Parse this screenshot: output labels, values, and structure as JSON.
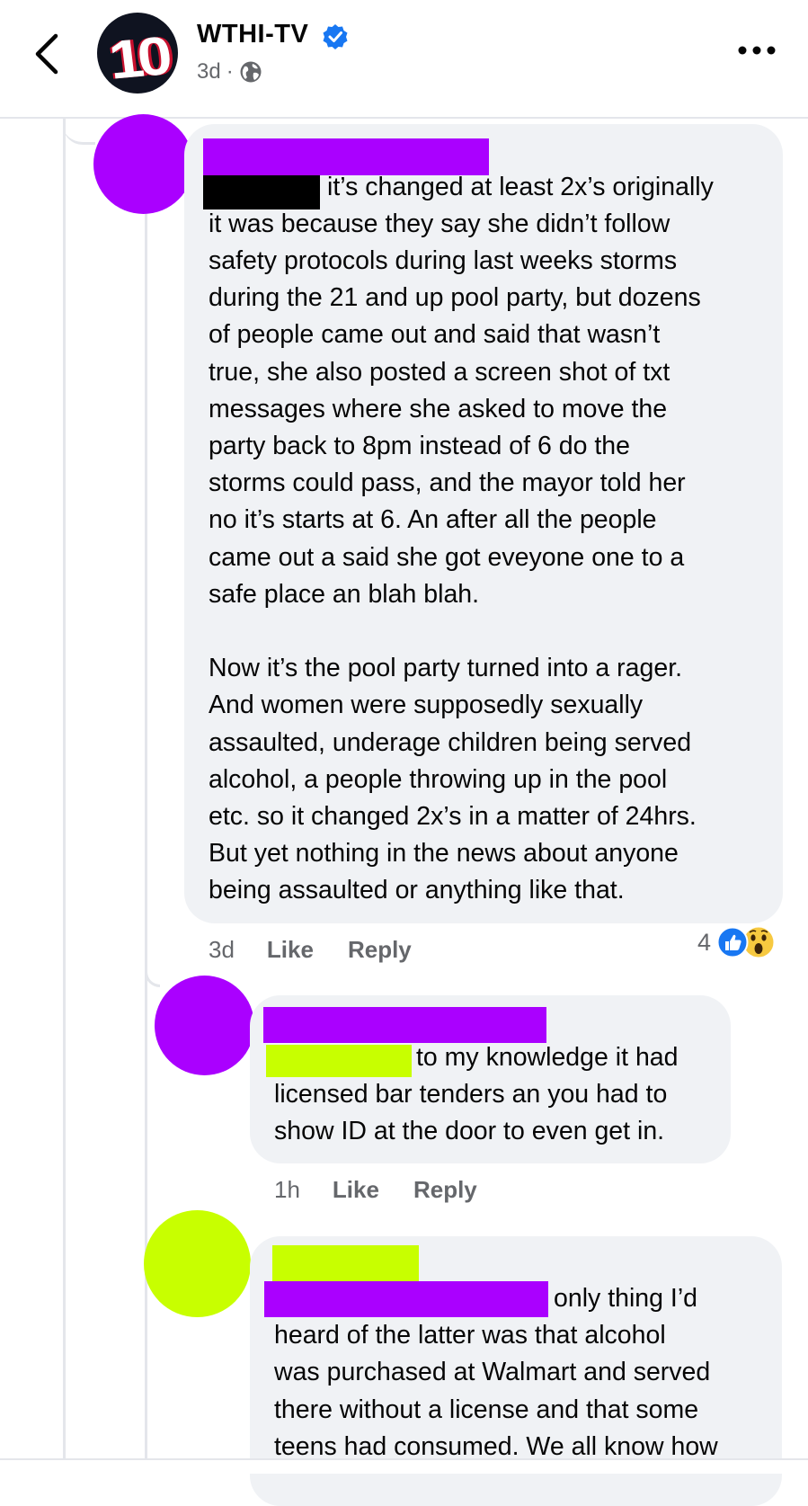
{
  "header": {
    "page_name": "WTHI-TV",
    "logo_text": "10",
    "time": "3d",
    "separator": "·"
  },
  "comments": [
    {
      "avatar_color": "#aa00ff",
      "lines": [
        "it’s changed at least 2x’s originally",
        "it was because they say she didn’t follow",
        "safety protocols during last weeks storms",
        "during the 21 and up pool party, but dozens",
        "of people came out and said that wasn’t",
        "true, she also posted a screen shot of txt",
        "messages where she asked to move the",
        "party back to 8pm instead of 6 do the",
        "storms could pass, and the mayor told her",
        "no it’s starts at 6. An after all the people",
        "came out a said she got eveyone one to a",
        "safe place an blah blah.",
        "",
        "Now it’s the pool party turned into a rager.",
        "And women were supposedly sexually",
        "assaulted, underage children being served",
        "alcohol, a people throwing up in the pool",
        "etc. so it changed 2x’s in a matter of 24hrs.",
        "But yet nothing in the news about anyone",
        "being assaulted or anything like that."
      ],
      "time": "3d",
      "like_label": "Like",
      "reply_label": "Reply",
      "reaction_count": "4"
    },
    {
      "avatar_color": "#aa00ff",
      "lines": [
        "to my knowledge it had",
        "licensed bar tenders an you had to",
        "show ID at the door to even get in."
      ],
      "time": "1h",
      "like_label": "Like",
      "reply_label": "Reply"
    },
    {
      "avatar_color": "#c8ff00",
      "lines": [
        "only thing I’d",
        "heard of the latter was that alcohol",
        "was purchased at Walmart and served",
        "there without a license and that some",
        "teens had consumed. We all know how"
      ]
    }
  ],
  "colors": {
    "purple_redaction": "#aa00ff",
    "lime_redaction": "#c8ff00",
    "black_redaction": "#000000",
    "like_blue": "#1877f2",
    "verified_blue": "#1877f2"
  }
}
